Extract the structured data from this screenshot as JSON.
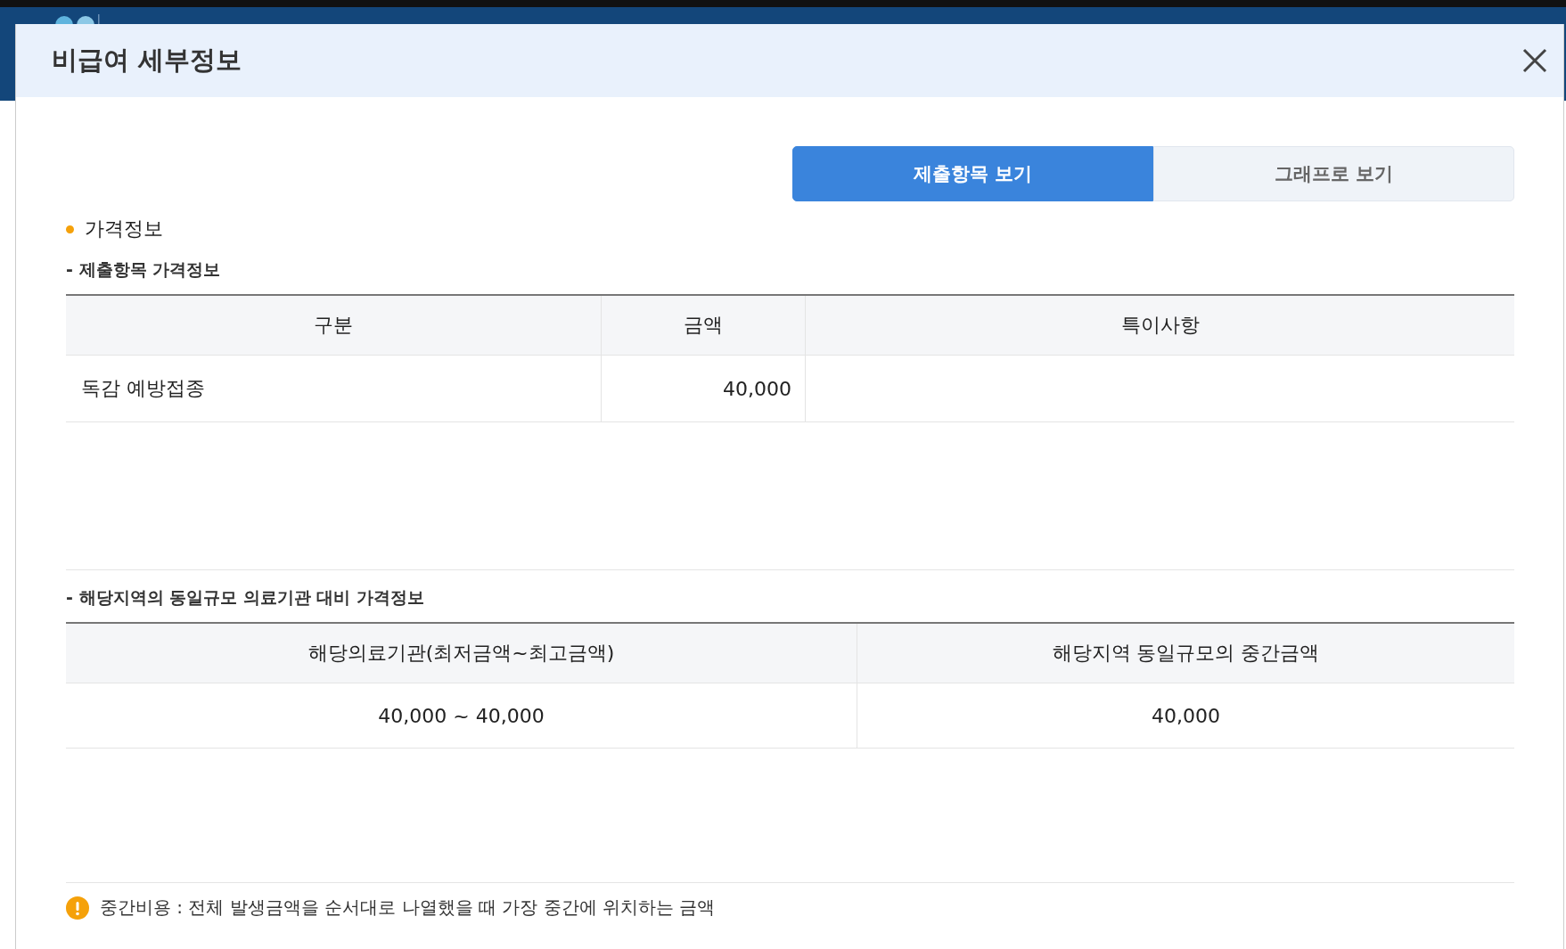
{
  "dialog": {
    "title": "비급여 세부정보"
  },
  "tabs": [
    {
      "label": "제출항목 보기",
      "selected": true
    },
    {
      "label": "그래프로 보기",
      "selected": false
    }
  ],
  "section_title": "가격정보",
  "price_table": {
    "subtitle": "- 제출항목 가격정보",
    "columns": [
      "구분",
      "금액",
      "특이사항"
    ],
    "rows": [
      [
        "독감 예방접종",
        "40,000",
        ""
      ]
    ]
  },
  "compare_table": {
    "subtitle": "- 해당지역의 동일규모 의료기관 대비 가격정보",
    "columns": [
      "해당의료기관(최저금액~최고금액)",
      "해당지역 동일규모의 중간금액"
    ],
    "rows": [
      [
        "40,000 ~ 40,000",
        "40,000"
      ]
    ]
  },
  "footnote": "중간비용 : 전체 발생금액을 순서대로 나열했을 때 가장 중간에 위치하는 금액"
}
